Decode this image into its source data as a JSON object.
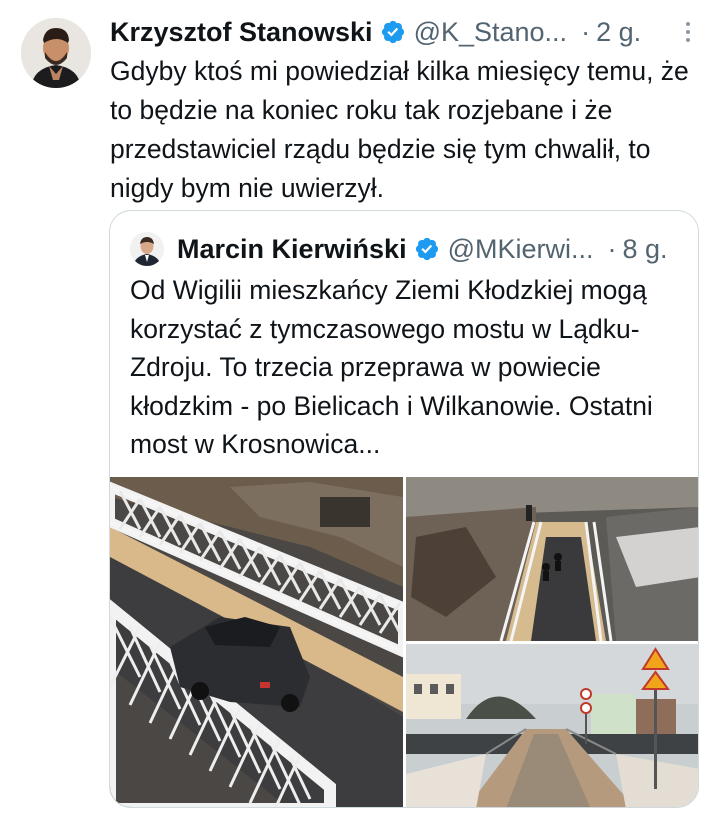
{
  "post": {
    "author": {
      "name": "Krzysztof Stanowski",
      "handle": "@K_Stano...",
      "time": "2 g."
    },
    "separator": "·",
    "text": "Gdyby ktoś mi powiedział kilka miesięcy temu, że to będzie na koniec roku tak rozjebane i że przedstawiciel rządu będzie się tym chwalił, to nigdy bym nie uwierzył."
  },
  "quoted": {
    "author": {
      "name": "Marcin Kierwiński",
      "handle": "@MKierwi...",
      "time": "8 g."
    },
    "separator": "·",
    "text": "Od Wigilii mieszkańcy Ziemi Kłodzkiej mogą korzystać z tymczasowego mostu w Lądku-Zdroju. To trzecia przeprawa w powiecie kłodzkim - po Bielicach i Wilkanowie. Ostatni most w Krosnowica..."
  },
  "colors": {
    "verified": "#1d9bf0",
    "secondary_text": "#536471",
    "border": "#cfd9de"
  },
  "icons": [
    "verified-badge-icon",
    "more-options-icon"
  ]
}
